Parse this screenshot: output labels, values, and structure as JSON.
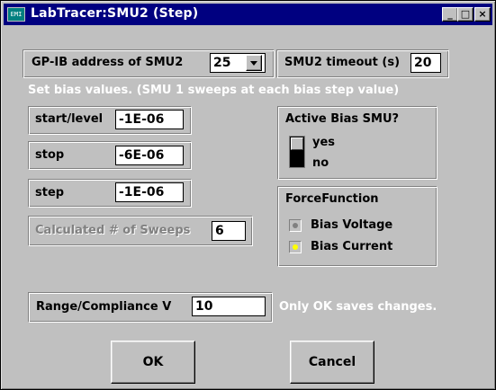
{
  "window": {
    "title": "LabTracer:SMU2 (Step)",
    "icon_text": "EMI",
    "controls": {
      "minimize": "_",
      "maximize": "□",
      "close": "×"
    }
  },
  "gpib": {
    "label": "GP-IB address of SMU2",
    "value": "25"
  },
  "timeout": {
    "label": "SMU2 timeout (s)",
    "value": "20"
  },
  "instructions": "Set bias values.  (SMU 1 sweeps at each bias step value)",
  "start": {
    "label": "start/level",
    "value": "-1E-06"
  },
  "stop": {
    "label": "stop",
    "value": "-6E-06"
  },
  "step": {
    "label": "step",
    "value": "-1E-06"
  },
  "sweeps": {
    "label": "Calculated # of Sweeps",
    "value": "6"
  },
  "active_bias": {
    "label": "Active Bias SMU?",
    "yes_label": "yes",
    "no_label": "no",
    "state": "no"
  },
  "force_function": {
    "label": "ForceFunction",
    "options": [
      {
        "label": "Bias Voltage",
        "selected": false
      },
      {
        "label": "Bias Current",
        "selected": true
      }
    ],
    "led_on_color": "#ffff00",
    "led_off_color": "#808080"
  },
  "range": {
    "label": "Range/Compliance V",
    "value": "10"
  },
  "note": "Only OK saves changes.",
  "buttons": {
    "ok": "OK",
    "cancel": "Cancel"
  }
}
